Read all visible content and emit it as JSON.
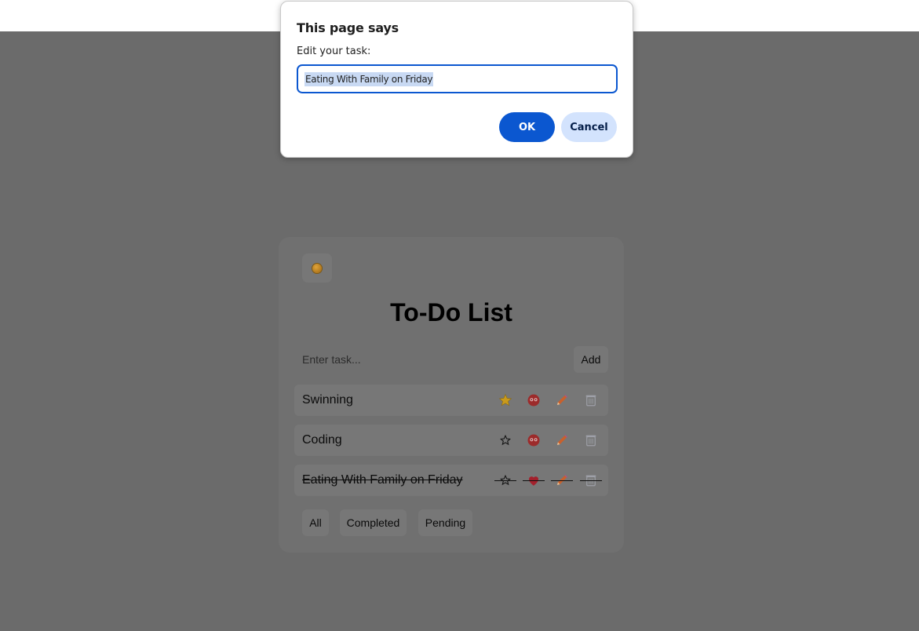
{
  "dialog": {
    "title": "This page says",
    "message": "Edit your task:",
    "input_value": "Eating With Family on Friday",
    "ok_label": "OK",
    "cancel_label": "Cancel",
    "accent_color": "#0b57d0"
  },
  "app": {
    "title": "To-Do List",
    "theme_toggle_icon": "sun-icon",
    "input_placeholder": "Enter task...",
    "add_label": "Add",
    "tasks": [
      {
        "text": "Swinning",
        "starred": true,
        "completed": false
      },
      {
        "text": "Coding",
        "starred": false,
        "completed": false
      },
      {
        "text": "Eating With Family on Friday",
        "starred": false,
        "completed": true
      }
    ],
    "task_action_icons": [
      "star-icon",
      "favorite-icon",
      "pencil-icon",
      "trash-icon"
    ],
    "filters": [
      "All",
      "Completed",
      "Pending"
    ]
  },
  "colors": {
    "overlay": "#6b6b6b",
    "card": "#707070",
    "star": "#e3b21f",
    "pencil": "#e0632b"
  }
}
